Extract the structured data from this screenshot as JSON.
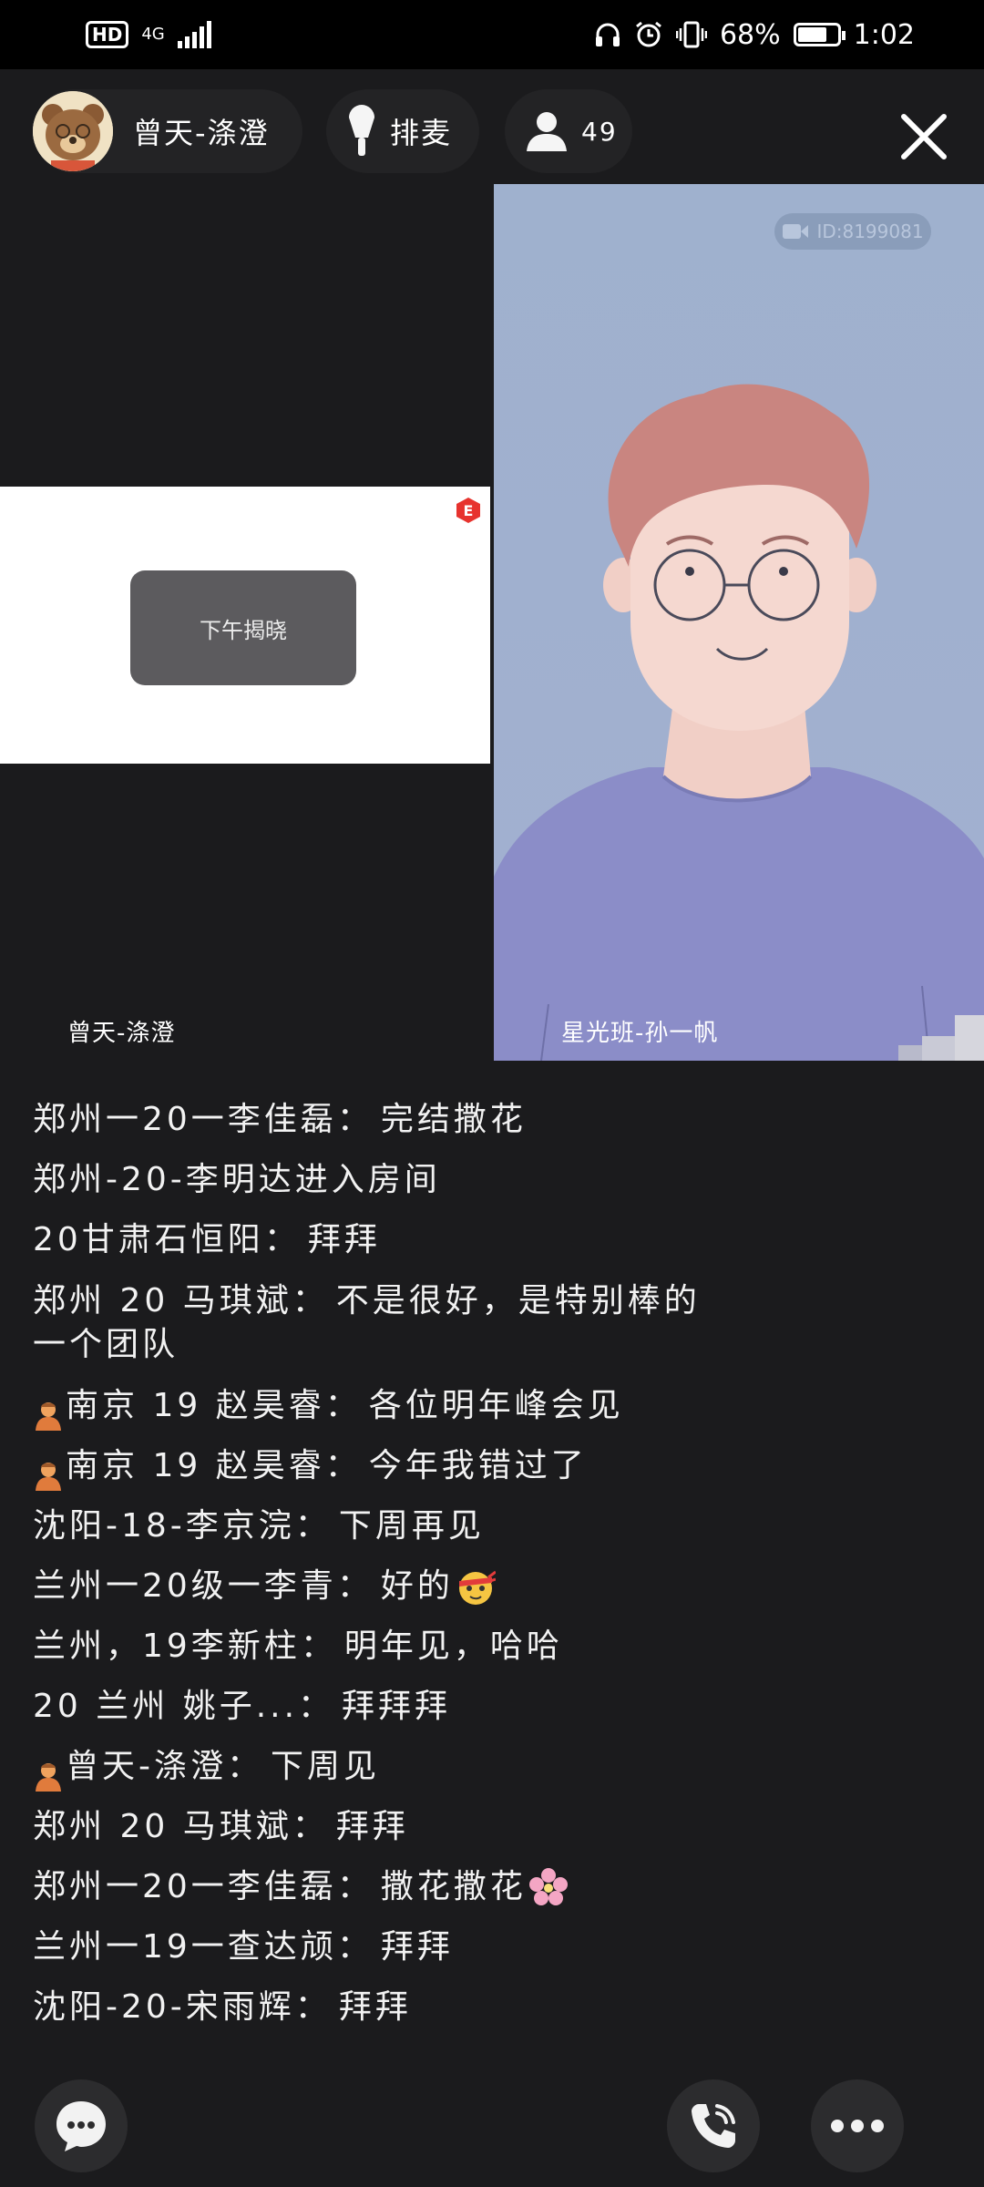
{
  "status_bar": {
    "hd": "HD",
    "network": "4G",
    "battery_percent": "68%",
    "battery_level": 0.68,
    "time": "1:02"
  },
  "header": {
    "host_name": "曾天-涤澄",
    "queue_label": "排麦",
    "viewer_count": "49"
  },
  "video": {
    "share_popup_text": "下午揭晓",
    "left_label": "曾天-涤澄",
    "right_label": "星光班-孙一帆",
    "id_badge": "ID:8199081"
  },
  "chat": {
    "messages": [
      {
        "sender": "郑州一20一李佳磊",
        "sep": "：",
        "text": "完结撒花",
        "host": false,
        "emoji": ""
      },
      {
        "sender": "郑州-20-李明达进入房间",
        "sep": "",
        "text": "",
        "host": false,
        "emoji": ""
      },
      {
        "sender": "20甘肃石恒阳",
        "sep": "：",
        "text": "拜拜",
        "host": false,
        "emoji": ""
      },
      {
        "sender": "郑州 20 马琪斌",
        "sep": "：",
        "text": "不是很好，是特别棒的一个团队",
        "host": false,
        "emoji": "",
        "multi": true
      },
      {
        "sender": "南京 19 赵昊睿",
        "sep": "：",
        "text": "各位明年峰会见",
        "host": true,
        "emoji": ""
      },
      {
        "sender": "南京 19 赵昊睿",
        "sep": "：",
        "text": "今年我错过了",
        "host": true,
        "emoji": ""
      },
      {
        "sender": "沈阳-18-李京浣",
        "sep": "：",
        "text": "下周再见",
        "host": false,
        "emoji": ""
      },
      {
        "sender": "兰州一20级一李青",
        "sep": "：",
        "text": "好的",
        "host": false,
        "emoji": "ninja"
      },
      {
        "sender": "兰州，19李新柱",
        "sep": "：",
        "text": "明年见，哈哈",
        "host": false,
        "emoji": ""
      },
      {
        "sender": "20 兰州 姚子...",
        "sep": "：",
        "text": "拜拜拜",
        "host": false,
        "emoji": ""
      },
      {
        "sender": "曾天-涤澄",
        "sep": "：",
        "text": "下周见",
        "host": true,
        "emoji": ""
      },
      {
        "sender": "郑州 20 马琪斌",
        "sep": "：",
        "text": "拜拜",
        "host": false,
        "emoji": ""
      },
      {
        "sender": "郑州一20一李佳磊",
        "sep": "：",
        "text": "撒花撒花",
        "host": false,
        "emoji": "blossom"
      },
      {
        "sender": "兰州一19一查达颃",
        "sep": "：",
        "text": "拜拜",
        "host": false,
        "emoji": ""
      },
      {
        "sender": "沈阳-20-宋雨辉",
        "sep": "：",
        "text": "拜拜",
        "host": false,
        "emoji": ""
      }
    ]
  },
  "icons": {
    "chat": "chat-bubble-icon",
    "call": "phone-icon",
    "more": "more-dots-icon",
    "close": "close-icon",
    "mic": "microphone-icon",
    "person": "person-icon"
  }
}
